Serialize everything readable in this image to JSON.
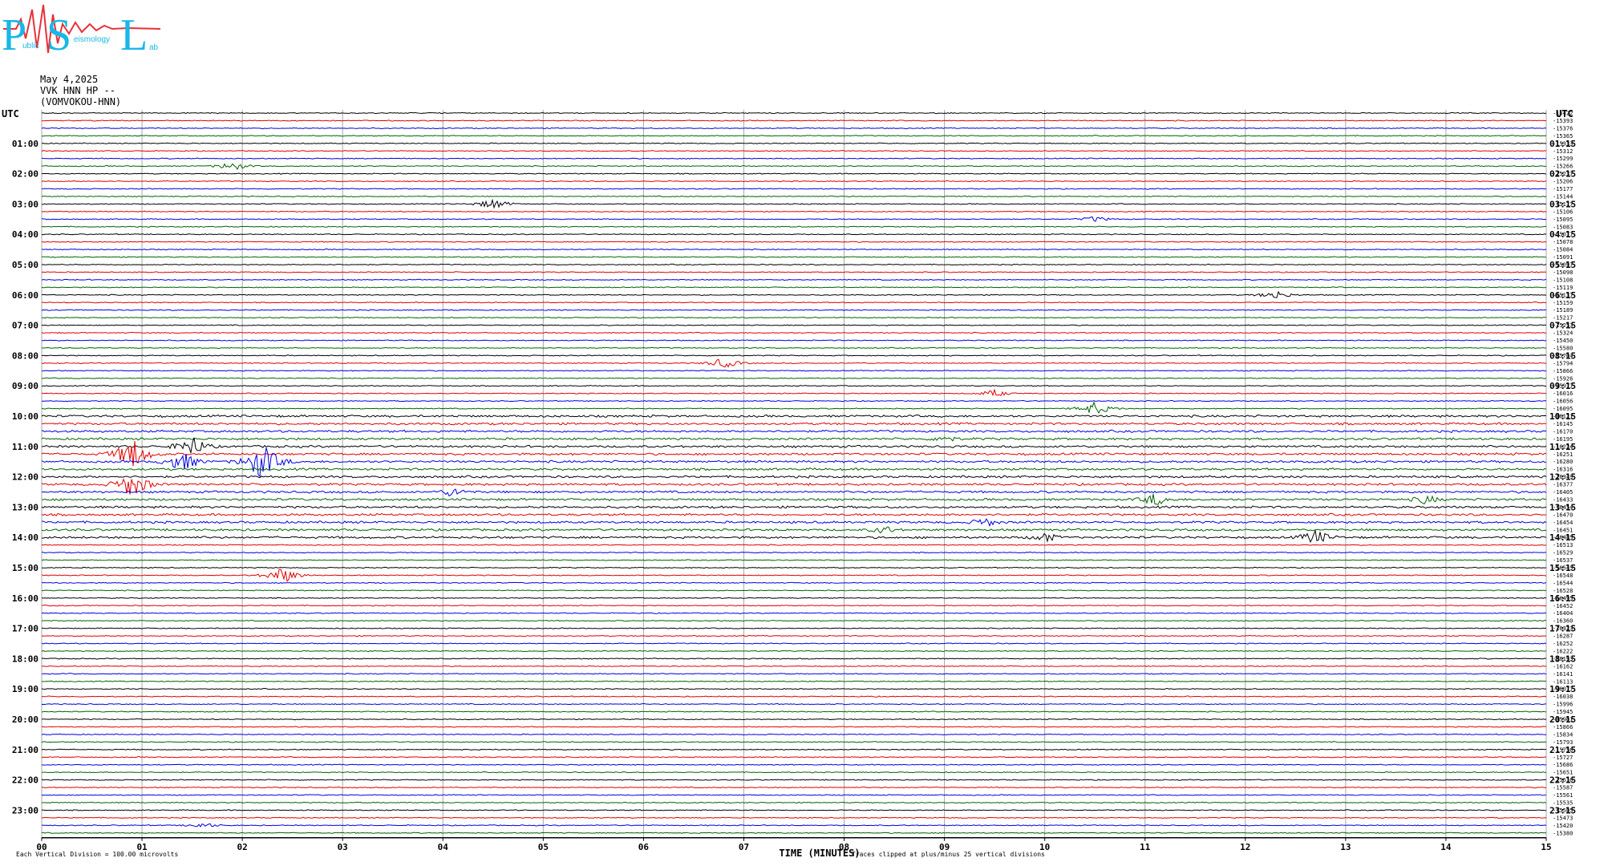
{
  "logo": {
    "letters": [
      "P",
      "S",
      "L"
    ],
    "words": [
      "ublic",
      "eismology",
      "ab"
    ],
    "colors": {
      "letters": "#19b7e6",
      "trace": "#e8303a"
    }
  },
  "header": {
    "date": "May 4,2025",
    "station": "VVK HNN HP --",
    "site": "(VOMVOKOU-HNN)"
  },
  "chart_data": {
    "type": "helicorder",
    "left_axis_title": "UTC",
    "right_axis_title": "UTC",
    "left_hour_labels": [
      "01:00",
      "02:00",
      "03:00",
      "04:00",
      "05:00",
      "06:00",
      "07:00",
      "08:00",
      "09:00",
      "10:00",
      "11:00",
      "12:00",
      "13:00",
      "14:00",
      "15:00",
      "16:00",
      "17:00",
      "18:00",
      "19:00",
      "20:00",
      "21:00",
      "22:00",
      "23:00"
    ],
    "right_hour_labels": [
      "01:15",
      "02:15",
      "03:15",
      "04:15",
      "05:15",
      "06:15",
      "07:15",
      "08:15",
      "09:15",
      "10:15",
      "11:15",
      "12:15",
      "13:15",
      "14:15",
      "15:15",
      "16:15",
      "17:15",
      "18:15",
      "19:15",
      "20:15",
      "21:15",
      "22:15",
      "23:15"
    ],
    "x_ticks": [
      "00",
      "01",
      "02",
      "03",
      "04",
      "05",
      "06",
      "07",
      "08",
      "09",
      "10",
      "11",
      "12",
      "13",
      "14",
      "15"
    ],
    "xlabel": "TIME (MINUTES)",
    "xlim": [
      0,
      15
    ],
    "minutes_per_line": 15,
    "trace_count": 96,
    "trace_colors": [
      "#000000",
      "#e00000",
      "#0000e0",
      "#006400"
    ],
    "line_offsets": [
      "-15422",
      "-15393",
      "-15376",
      "-15365",
      "-15333",
      "-15312",
      "-15299",
      "-15266",
      "-15237",
      "-15206",
      "-15177",
      "-15144",
      "-15117",
      "-15106",
      "-15095",
      "-15083",
      "-15077",
      "-15078",
      "-15084",
      "-15091",
      "-15097",
      "-15098",
      "-15108",
      "-15119",
      "-15137",
      "-15159",
      "-15189",
      "-15217",
      "-15253",
      "-15324",
      "-15450",
      "-15580",
      "-15704",
      "-15794",
      "-15866",
      "-15926",
      "-15977",
      "-16016",
      "-16056",
      "-16095",
      "-16121",
      "-16145",
      "-16170",
      "-16195",
      "-16224",
      "-16251",
      "-16280",
      "-16316",
      "-16349",
      "-16377",
      "-16405",
      "-16433",
      "-16454",
      "-16470",
      "-16454",
      "-16451",
      "-16485",
      "-16513",
      "-16529",
      "-16537",
      "-16545",
      "-16548",
      "-16544",
      "-16528",
      "-16495",
      "-16452",
      "-16404",
      "-16360",
      "-16323",
      "-16287",
      "-16252",
      "-16222",
      "-16193",
      "-16162",
      "-16141",
      "-16113",
      "-16077",
      "-16038",
      "-15996",
      "-15945",
      "-15901",
      "-15866",
      "-15834",
      "-15793",
      "-15756",
      "-15727",
      "-15686",
      "-15651",
      "-15616",
      "-15587",
      "-15561",
      "-15535",
      "-15505",
      "-15473",
      "-15420",
      "-15380"
    ],
    "events": [
      {
        "trace": 7,
        "minute": 1.9,
        "amp": 6
      },
      {
        "trace": 12,
        "minute": 4.5,
        "amp": 7
      },
      {
        "trace": 14,
        "minute": 10.5,
        "amp": 4
      },
      {
        "trace": 24,
        "minute": 12.3,
        "amp": 6
      },
      {
        "trace": 33,
        "minute": 6.8,
        "amp": 7
      },
      {
        "trace": 37,
        "minute": 9.5,
        "amp": 5
      },
      {
        "trace": 39,
        "minute": 10.5,
        "amp": 9
      },
      {
        "trace": 43,
        "minute": 9.0,
        "amp": 6
      },
      {
        "trace": 44,
        "minute": 1.5,
        "amp": 14
      },
      {
        "trace": 45,
        "minute": 0.9,
        "amp": 22
      },
      {
        "trace": 46,
        "minute": 1.4,
        "amp": 14
      },
      {
        "trace": 46,
        "minute": 2.2,
        "amp": 26
      },
      {
        "trace": 49,
        "minute": 0.9,
        "amp": 18
      },
      {
        "trace": 50,
        "minute": 4.1,
        "amp": 7
      },
      {
        "trace": 51,
        "minute": 11.1,
        "amp": 9
      },
      {
        "trace": 51,
        "minute": 13.8,
        "amp": 7
      },
      {
        "trace": 54,
        "minute": 9.4,
        "amp": 7
      },
      {
        "trace": 55,
        "minute": 8.4,
        "amp": 6
      },
      {
        "trace": 56,
        "minute": 10.0,
        "amp": 7
      },
      {
        "trace": 56,
        "minute": 12.7,
        "amp": 11
      },
      {
        "trace": 61,
        "minute": 2.4,
        "amp": 11
      },
      {
        "trace": 94,
        "minute": 1.6,
        "amp": 4
      }
    ]
  },
  "footer": {
    "left_note": "Each Vertical Division =  100.00 microvolts",
    "right_note": "Traces clipped at plus/minus 25 vertical divisions"
  }
}
